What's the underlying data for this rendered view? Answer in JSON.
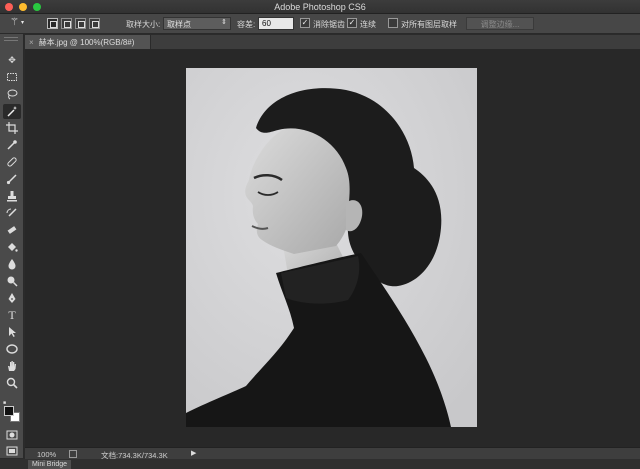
{
  "window": {
    "title": "Adobe Photoshop CS6"
  },
  "options_bar": {
    "tool_icon": "magic-wand-icon",
    "sample_size_label": "取样大小:",
    "sample_size_value": "取样点",
    "tolerance_label": "容差:",
    "tolerance_value": "60",
    "anti_alias_label": "消除锯齿",
    "anti_alias_checked": true,
    "contiguous_label": "连续",
    "contiguous_checked": true,
    "sample_all_layers_label": "对所有图层取样",
    "sample_all_layers_checked": false,
    "refine_edge_label": "调整边缘..."
  },
  "document": {
    "tab_title": "赫本.jpg @ 100%(RGB/8#)",
    "close_glyph": "×"
  },
  "status_bar": {
    "zoom": "100%",
    "doc_info": "文档:734.3K/734.3K",
    "arrow": "▶"
  },
  "panels": {
    "mini_bridge_label": "Mini Bridge"
  },
  "tools": [
    "move-icon",
    "marquee-icon",
    "lasso-icon",
    "magic-wand-icon",
    "crop-icon",
    "eyedropper-icon",
    "healing-brush-icon",
    "brush-icon",
    "clone-stamp-icon",
    "history-brush-icon",
    "eraser-icon",
    "paint-bucket-icon",
    "blur-icon",
    "dodge-icon",
    "pen-icon",
    "type-icon",
    "path-selection-icon",
    "shape-icon",
    "hand-icon",
    "zoom-icon"
  ],
  "colors": {
    "foreground": "#111111",
    "background": "#ffffff",
    "ui_dark": "#282828",
    "ui_panel": "#4a4a4a"
  }
}
